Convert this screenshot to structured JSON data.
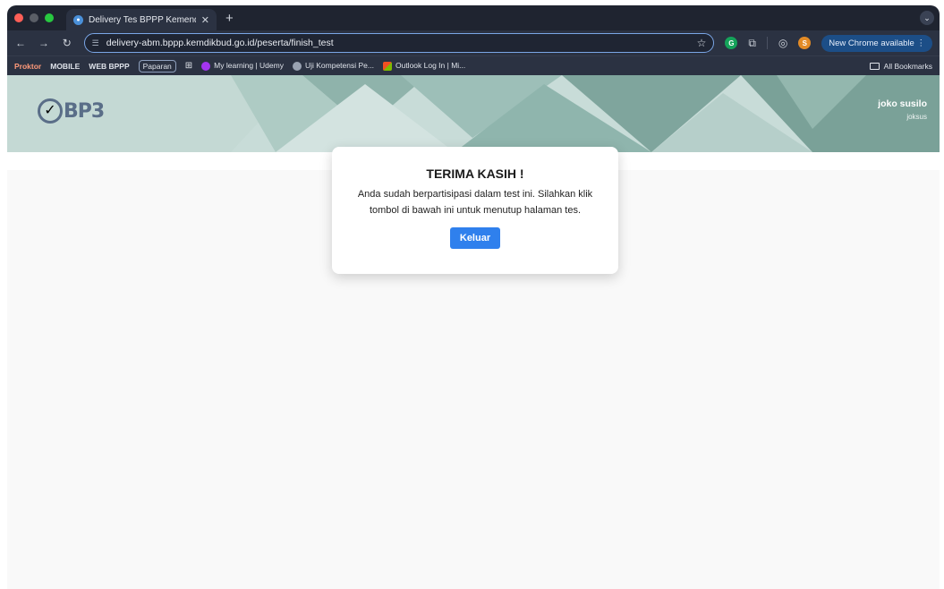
{
  "browser": {
    "tab_title": "Delivery Tes BPPP Kemendik",
    "url": "delivery-abm.bppp.kemdikbud.go.id/peserta/finish_test",
    "new_chrome_label": "New Chrome available",
    "profile_initial": "S",
    "bookmarks": {
      "proktor": "Proktor",
      "mobile": "MOBILE",
      "web_bppp": "WEB BPPP",
      "paparan": "Paparan",
      "udemy": "My learning | Udemy",
      "uji": "Uji Kompetensi Pe...",
      "outlook": "Outlook Log In | Mi...",
      "all_bookmarks": "All Bookmarks"
    }
  },
  "header": {
    "logo_text": "BP3",
    "user_name": "joko susilo",
    "user_username": "joksus"
  },
  "modal": {
    "title": "TERIMA KASIH !",
    "message": "Anda sudah berpartisipasi dalam test ini. Silahkan klik tombol di bawah ini untuk menutup halaman tes.",
    "button_label": "Keluar"
  },
  "colors": {
    "accent": "#2f80ed",
    "banner": "#c8dcd8",
    "banner_dark": "#7fa39b"
  }
}
